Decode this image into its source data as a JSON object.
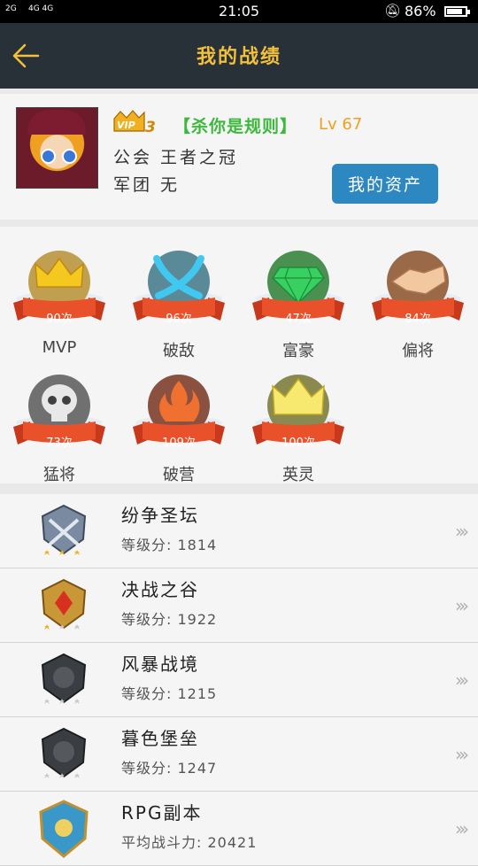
{
  "status_bar": {
    "signal_left": "2G",
    "signal_right": "4G 4G",
    "time": "21:05",
    "battery": "86%"
  },
  "header": {
    "title": "我的战绩"
  },
  "profile": {
    "vip_level": "3",
    "name": "【杀你是规则】",
    "level": "Lv 67",
    "guild": "公会 王者之冠",
    "corps": "军团 无",
    "assets_button": "我的资产"
  },
  "achievements": [
    {
      "label": "MVP",
      "count": "90次",
      "icon": "crown-icon",
      "color": "#f5b820"
    },
    {
      "label": "破敌",
      "count": "96次",
      "icon": "crossed-swords-icon",
      "color": "#3fb2d8"
    },
    {
      "label": "富豪",
      "count": "47次",
      "icon": "diamond-icon",
      "color": "#34c35a"
    },
    {
      "label": "偏将",
      "count": "84次",
      "icon": "handshake-icon",
      "color": "#e8a070"
    },
    {
      "label": "猛将",
      "count": "73次",
      "icon": "skull-icon",
      "color": "#d0d0d0"
    },
    {
      "label": "破营",
      "count": "109次",
      "icon": "flame-icon",
      "color": "#f0603a"
    },
    {
      "label": "英灵",
      "count": "100次",
      "icon": "crown-spirit-icon",
      "color": "#f5e060"
    }
  ],
  "modes": [
    {
      "name": "纷争圣坛",
      "score_label": "等级分:",
      "score": "1814",
      "stars": 3,
      "medal": "silver-crest-icon"
    },
    {
      "name": "决战之谷",
      "score_label": "等级分:",
      "score": "1922",
      "stars": 1,
      "medal": "gold-crest-icon"
    },
    {
      "name": "风暴战境",
      "score_label": "等级分:",
      "score": "1215",
      "stars": 0,
      "medal": "dark-shield-icon"
    },
    {
      "name": "暮色堡垒",
      "score_label": "等级分:",
      "score": "1247",
      "stars": 0,
      "medal": "dark-shield-icon"
    },
    {
      "name": "RPG副本",
      "score_label": "平均战斗力:",
      "score": "20421",
      "stars": null,
      "medal": "ornate-crest-icon"
    }
  ],
  "colors": {
    "header_bg": "#283038",
    "title": "#f2c03b",
    "name": "#3cb83c",
    "level": "#f0a020",
    "button": "#2d87c0",
    "ribbon": "#e8512a"
  }
}
